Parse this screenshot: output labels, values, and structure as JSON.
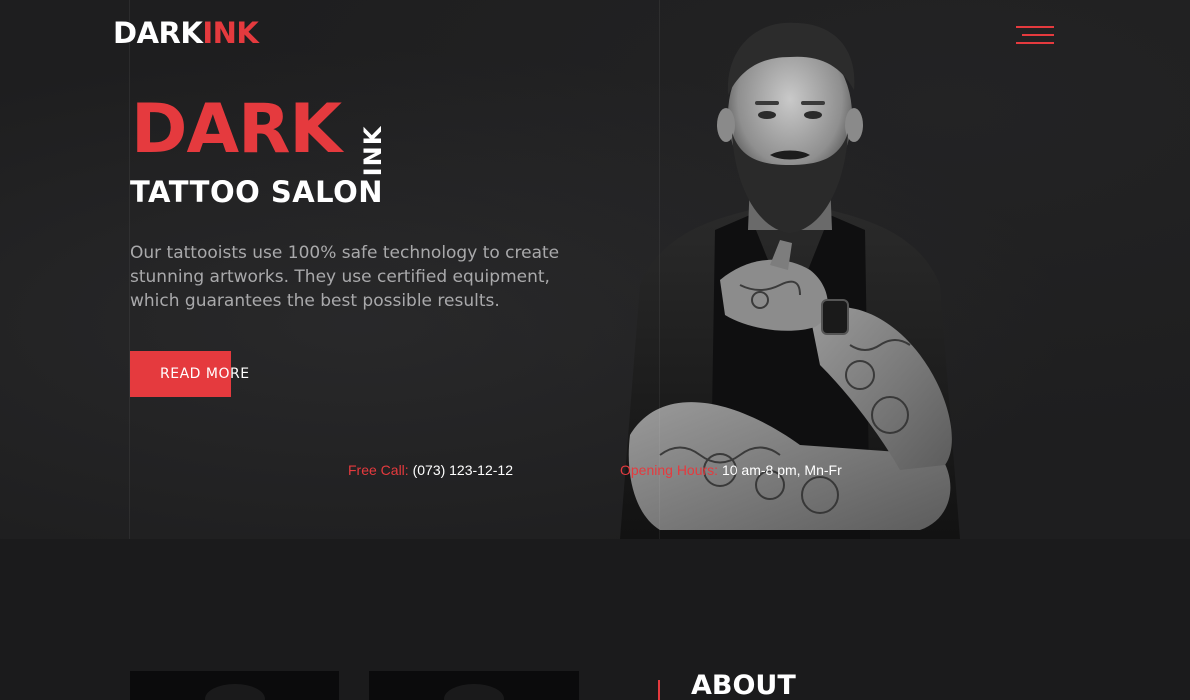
{
  "brand": {
    "logo_dark": "DARK",
    "logo_ink": "INK",
    "accent": "#e53a3e"
  },
  "nav": {
    "menu_icon": "hamburger-icon"
  },
  "hero": {
    "title_main": "DARK",
    "title_vertical": "INK",
    "subtitle": "TATTOO SALON",
    "description": "Our tattooists use 100% safe technology to create stunning artworks. They use certified equipment, which guarantees the best possible results.",
    "cta_label": "READ MORE",
    "call_label": "Free Call:",
    "call_value": "(073) 123-12-12",
    "hours_label": "Opening Hours:",
    "hours_value": "10 am-8 pm, Mn-Fr"
  },
  "about": {
    "title": "ABOUT"
  }
}
